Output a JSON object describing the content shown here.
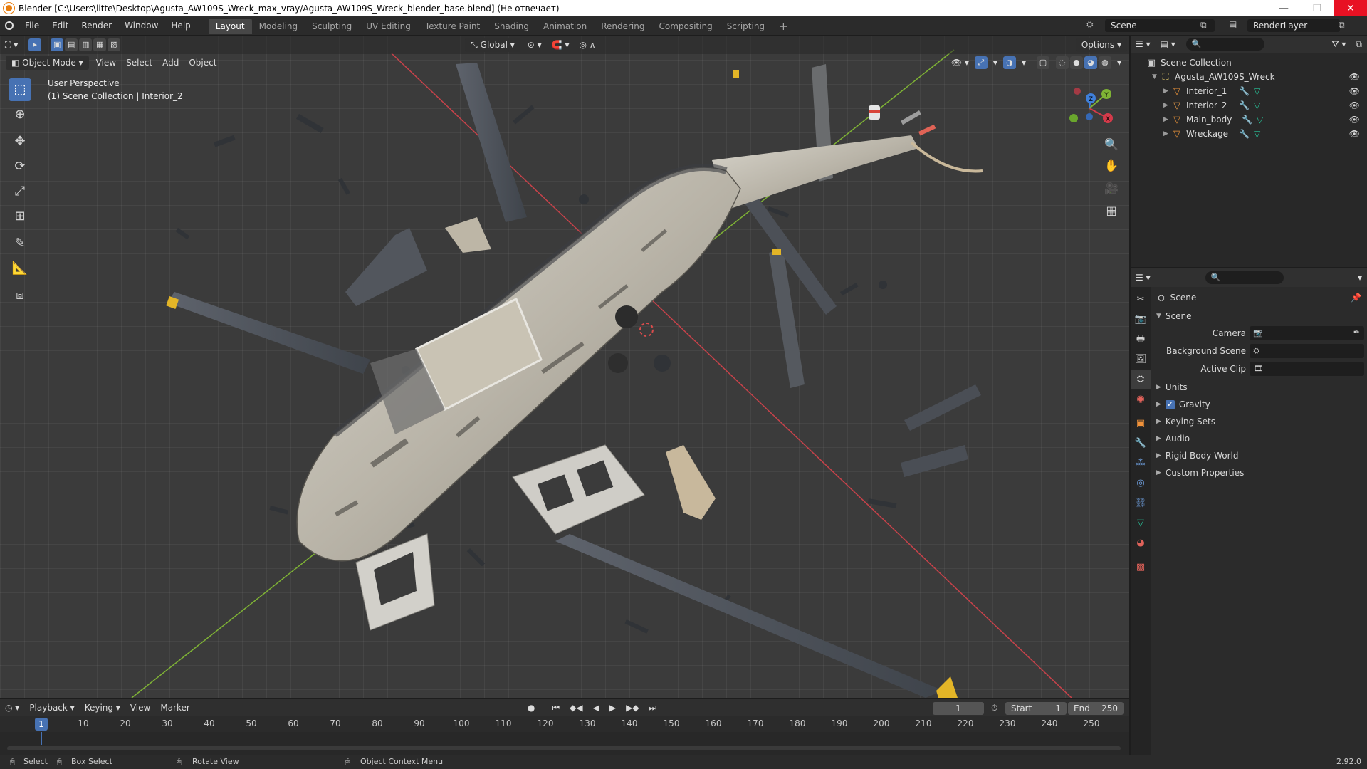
{
  "window": {
    "title": "Blender [C:\\Users\\litte\\Desktop\\Agusta_AW109S_Wreck_max_vray/Agusta_AW109S_Wreck_blender_base.blend] (Не отвечает)",
    "minimize": "—",
    "maximize": "❐",
    "close": "✕"
  },
  "menubar": {
    "items": [
      "File",
      "Edit",
      "Render",
      "Window",
      "Help"
    ],
    "workspaces": [
      "Layout",
      "Modeling",
      "Sculpting",
      "UV Editing",
      "Texture Paint",
      "Shading",
      "Animation",
      "Rendering",
      "Compositing",
      "Scripting"
    ],
    "active_workspace": "Layout",
    "add_workspace": "+",
    "scene": "Scene",
    "view_layer": "RenderLayer"
  },
  "viewport": {
    "transform_orientation": "Global",
    "options": "Options",
    "mode": "Object Mode",
    "menus": [
      "View",
      "Select",
      "Add",
      "Object"
    ],
    "overlay_line1": "User Perspective",
    "overlay_line2": "(1) Scene Collection | Interior_2",
    "tools": [
      "select-box",
      "cursor",
      "move",
      "rotate",
      "scale",
      "transform",
      "annotate",
      "measure",
      "add-cube"
    ],
    "active_tool": "select-box",
    "gizmo_axes": {
      "x": "X",
      "y": "Y",
      "z": "Z"
    },
    "colors": {
      "x_axis": "#d43a4a",
      "y_axis": "#7fb335",
      "z_axis": "#3f7fd9"
    }
  },
  "outliner": {
    "root": "Scene Collection",
    "collection": "Agusta_AW109S_Wreck",
    "objects": [
      "Interior_1",
      "Interior_2",
      "Main_body",
      "Wreckage"
    ]
  },
  "properties": {
    "context": "Scene",
    "panel": "Scene",
    "fields": [
      {
        "label": "Camera",
        "value": ""
      },
      {
        "label": "Background Scene",
        "value": ""
      },
      {
        "label": "Active Clip",
        "value": ""
      }
    ],
    "sections": [
      "Units",
      "Gravity",
      "Keying Sets",
      "Audio",
      "Rigid Body World",
      "Custom Properties"
    ],
    "gravity_checked": true
  },
  "timeline": {
    "menus": [
      "Playback",
      "Keying",
      "View",
      "Marker"
    ],
    "current_frame": "1",
    "start_label": "Start",
    "start": "1",
    "end_label": "End",
    "end": "250",
    "ticks": [
      "10",
      "20",
      "30",
      "40",
      "50",
      "60",
      "70",
      "80",
      "90",
      "100",
      "110",
      "120",
      "130",
      "140",
      "150",
      "160",
      "170",
      "180",
      "190",
      "200",
      "210",
      "220",
      "230",
      "240",
      "250"
    ],
    "playhead_label": "1"
  },
  "statusbar": {
    "select": "Select",
    "box_select": "Box Select",
    "rotate_view": "Rotate View",
    "context_menu": "Object Context Menu",
    "version": "2.92.0"
  }
}
